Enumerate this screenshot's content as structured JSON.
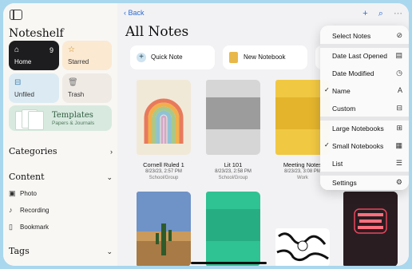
{
  "sidebar": {
    "title": "Noteshelf",
    "tiles": {
      "home": {
        "label": "Home",
        "count": "9"
      },
      "starred": {
        "label": "Starred"
      },
      "unfiled": {
        "label": "Unfiled"
      },
      "trash": {
        "label": "Trash"
      },
      "templates": {
        "title": "Templates",
        "subtitle": "Papers & Journals"
      }
    },
    "sections": {
      "categories": "Categories",
      "content": "Content",
      "tags": "Tags"
    },
    "content_items": [
      {
        "label": "Photo",
        "icon": "photo-icon"
      },
      {
        "label": "Recording",
        "icon": "microphone-icon"
      },
      {
        "label": "Bookmark",
        "icon": "bookmark-icon"
      }
    ]
  },
  "header": {
    "back_label": "Back",
    "title": "All Notes"
  },
  "actions": {
    "quick_note": "Quick Note",
    "new_notebook": "New Notebook"
  },
  "notebooks": [
    {
      "title": "Cornell Ruled 1",
      "date": "8/23/23, 2:57 PM",
      "group": "School/Group"
    },
    {
      "title": "Lit 101",
      "date": "8/23/23, 2:58 PM",
      "group": "School/Group"
    },
    {
      "title": "Meeting Notes",
      "date": "8/23/23, 3:08 PM",
      "group": "Work"
    }
  ],
  "menu": {
    "items": [
      {
        "label": "Select Notes",
        "icon": "check-circle-icon",
        "checked": false
      },
      {
        "label": "Date Last Opened",
        "icon": "calendar-icon",
        "checked": false
      },
      {
        "label": "Date Modified",
        "icon": "clock-icon",
        "checked": false
      },
      {
        "label": "Name",
        "icon": "letter-a-icon",
        "checked": true
      },
      {
        "label": "Custom",
        "icon": "custom-order-icon",
        "checked": false
      },
      {
        "label": "Large Notebooks",
        "icon": "grid-large-icon",
        "checked": false
      },
      {
        "label": "Small Notebooks",
        "icon": "grid-small-icon",
        "checked": true
      },
      {
        "label": "List",
        "icon": "list-icon",
        "checked": false
      },
      {
        "label": "Settings",
        "icon": "gear-icon",
        "checked": false
      }
    ]
  },
  "colors": {
    "accent": "#2a6bd6",
    "home_tile": "#1d1d1f",
    "starred_tile": "#fbe9d2",
    "unfiled_tile": "#dcebf3",
    "templates_tile": "#d8eadf"
  }
}
